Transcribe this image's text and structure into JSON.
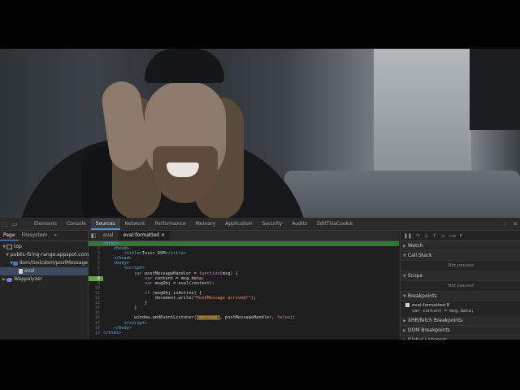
{
  "video": {
    "description_colors": {
      "accent": "#4d8fe6"
    }
  },
  "devtools": {
    "toolbar_icons": [
      "inspect-icon",
      "device-toolbar-icon"
    ],
    "tabs": [
      "Elements",
      "Console",
      "Sources",
      "Network",
      "Performance",
      "Memory",
      "Application",
      "Security",
      "Audits",
      "EditThisCookie"
    ],
    "active_tab": "Sources",
    "right_icons": [
      "more-vertical-icon",
      "close-icon"
    ]
  },
  "navigator": {
    "tabs": [
      "Page",
      "Filesystem",
      "»"
    ],
    "tree": [
      {
        "label": "top",
        "indent": 0,
        "icon": "frame-icon"
      },
      {
        "label": "public-firing-range.appspot.com",
        "indent": 1,
        "icon": "cloud-icon"
      },
      {
        "label": "dom/toxicdom/postMessage",
        "indent": 2,
        "icon": "folder-icon"
      },
      {
        "label": "eval",
        "indent": 3,
        "icon": "file-icon"
      },
      {
        "label": "Wappalyzer",
        "indent": 0,
        "icon": "cloud-icon"
      }
    ]
  },
  "editor": {
    "tabs": [
      "eval",
      "eval:formatted ×"
    ],
    "active_tab": "eval:formatted ×",
    "lines": [
      {
        "n": "1",
        "html": "<span class=\"tag\">&lt;html&gt;</span>"
      },
      {
        "n": "2",
        "html": "    <span class=\"tag\">&lt;head&gt;</span>"
      },
      {
        "n": "3",
        "html": "        <span class=\"tag\">&lt;title&gt;</span>Toxic DOM<span class=\"tag\">&lt;/title&gt;</span>"
      },
      {
        "n": "4",
        "html": "    <span class=\"tag\">&lt;/head&gt;</span>"
      },
      {
        "n": "5",
        "html": "    <span class=\"tag\">&lt;body&gt;</span>"
      },
      {
        "n": "6",
        "html": "        <span class=\"tag\">&lt;script&gt;</span>"
      },
      {
        "n": "7",
        "html": "            <span class=\"kw\">var</span> postMessageHandler = <span class=\"kw\">function</span>(msg) {"
      },
      {
        "n": "8",
        "html": "                <span class=\"kw\">var</span> content = msg.data;"
      },
      {
        "n": "9",
        "html": "                <span class=\"kw\">var</span> msgObj = eval(content);"
      },
      {
        "n": "10",
        "html": ""
      },
      {
        "n": "11",
        "html": "                <span class=\"kw\">if</span> (msgObj.isActive) {"
      },
      {
        "n": "12",
        "html": "                    document.write(<span class=\"str\">\"PostMessage arrived!\"</span>);"
      },
      {
        "n": "13",
        "html": "                }"
      },
      {
        "n": "14",
        "html": "            }"
      },
      {
        "n": "15",
        "html": ""
      },
      {
        "n": "16",
        "html": "            window.addEventListener(<span class=\"mark str\">'message'</span>, postMessageHandler, <span class=\"kw\">false</span>);"
      },
      {
        "n": "17",
        "html": "        <span class=\"tag\">&lt;/script&gt;</span>"
      },
      {
        "n": "18",
        "html": "    <span class=\"tag\">&lt;/body&gt;</span>"
      },
      {
        "n": "19",
        "html": "<span class=\"tag\">&lt;/html&gt;</span>"
      }
    ],
    "breakpoint_line": "8",
    "highlight_line": "1"
  },
  "debugger": {
    "sections": {
      "watch": "Watch",
      "call_stack": "Call Stack",
      "call_stack_status": "Not paused",
      "scope": "Scope",
      "scope_status": "Not paused",
      "breakpoints": "Breakpoints",
      "bp_label": "eval:formatted:8",
      "bp_code": "var content = msg.data;",
      "xhr": "XHR/fetch Breakpoints",
      "dom": "DOM Breakpoints",
      "global": "Global Listeners"
    }
  }
}
